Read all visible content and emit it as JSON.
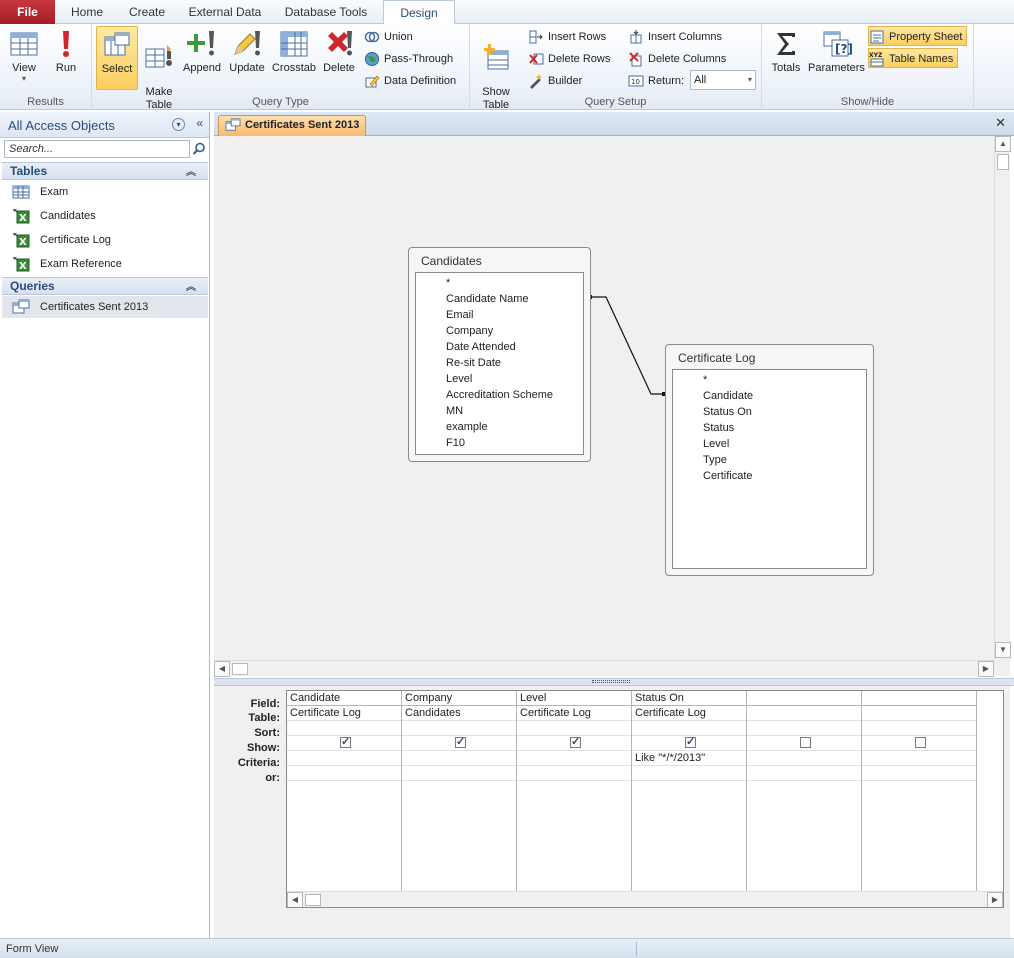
{
  "ribbon_tabs": [
    "File",
    "Home",
    "Create",
    "External Data",
    "Database Tools",
    "Design"
  ],
  "ribbon": {
    "results": {
      "label": "Results",
      "view": "View",
      "run": "Run"
    },
    "query_type": {
      "label": "Query Type",
      "select": "Select",
      "make_table": "Make\nTable",
      "append": "Append",
      "update": "Update",
      "crosstab": "Crosstab",
      "delete": "Delete",
      "union": "Union",
      "pass_through": "Pass-Through",
      "data_definition": "Data Definition"
    },
    "query_setup": {
      "label": "Query Setup",
      "show_table": "Show\nTable",
      "insert_rows": "Insert Rows",
      "delete_rows": "Delete Rows",
      "builder": "Builder",
      "insert_columns": "Insert Columns",
      "delete_columns": "Delete Columns",
      "return_label": "Return:",
      "return_value": "All"
    },
    "show_hide": {
      "label": "Show/Hide",
      "totals": "Totals",
      "parameters": "Parameters",
      "property_sheet": "Property Sheet",
      "table_names": "Table Names"
    }
  },
  "nav": {
    "title": "All Access Objects",
    "search_placeholder": "Search...",
    "tables_header": "Tables",
    "tables": [
      "Exam",
      "Candidates",
      "Certificate Log",
      "Exam Reference"
    ],
    "queries_header": "Queries",
    "queries": [
      "Certificates Sent 2013"
    ]
  },
  "document": {
    "tab_title": "Certificates Sent 2013",
    "field_lists": [
      {
        "title": "Candidates",
        "fields": [
          "*",
          "Candidate Name",
          "Email",
          "Company",
          "Date Attended",
          "Re-sit Date",
          "Level",
          "Accreditation Scheme",
          "MN",
          "example",
          "F10"
        ]
      },
      {
        "title": "Certificate Log",
        "fields": [
          "*",
          "Candidate",
          "Status On",
          "Status",
          "Level",
          "Type",
          "Certificate"
        ]
      }
    ]
  },
  "grid": {
    "row_labels": [
      "Field:",
      "Table:",
      "Sort:",
      "Show:",
      "Criteria:",
      "or:"
    ],
    "columns": [
      {
        "field": "Candidate",
        "table": "Certificate Log",
        "sort": "",
        "show": true,
        "criteria": "",
        "or": ""
      },
      {
        "field": "Company",
        "table": "Candidates",
        "sort": "",
        "show": true,
        "criteria": "",
        "or": ""
      },
      {
        "field": "Level",
        "table": "Certificate Log",
        "sort": "",
        "show": true,
        "criteria": "",
        "or": ""
      },
      {
        "field": "Status On",
        "table": "Certificate Log",
        "sort": "",
        "show": true,
        "criteria": "Like \"*/*/2013\"",
        "or": ""
      },
      {
        "field": "",
        "table": "",
        "sort": "",
        "show": false,
        "criteria": "",
        "or": ""
      },
      {
        "field": "",
        "table": "",
        "sort": "",
        "show": false,
        "criteria": "",
        "or": ""
      }
    ]
  },
  "status_bar": {
    "text": "Form View"
  },
  "colors": {
    "file_tab": "#b52b33",
    "accent_selected": "#fbcf5e",
    "doc_tab": "#f9b96b",
    "nav_header": "#2a4c7c"
  }
}
